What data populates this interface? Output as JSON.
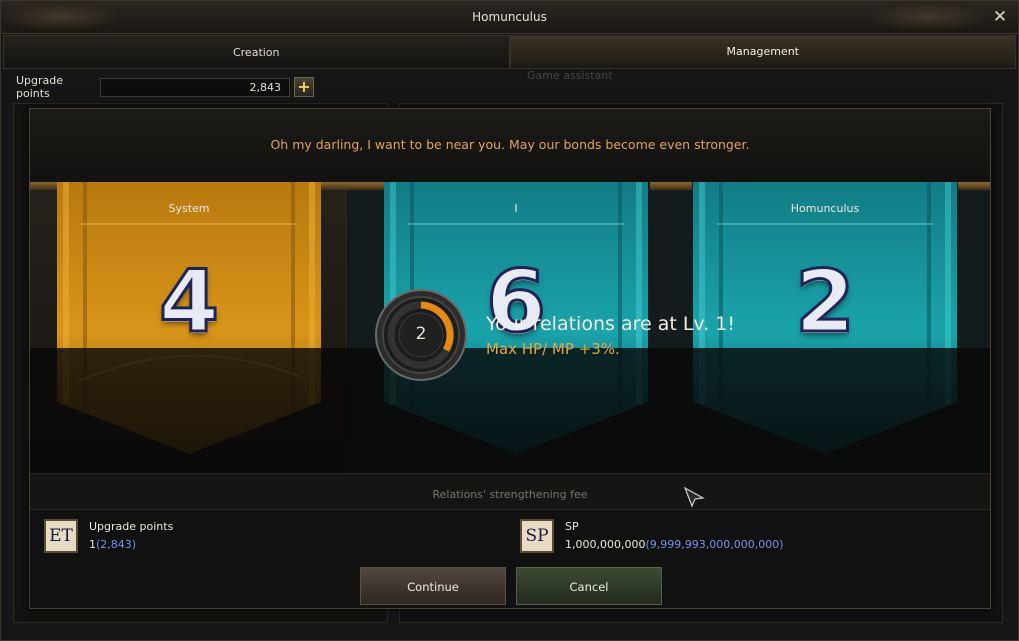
{
  "window": {
    "title": "Homunculus"
  },
  "tabs": [
    {
      "label": "Creation",
      "active": false
    },
    {
      "label": "Management",
      "active": true
    }
  ],
  "upgrade": {
    "label": "Upgrade points",
    "value": "2,843"
  },
  "background": {
    "assistant_text": "Game assistant"
  },
  "modal": {
    "message": "Oh my darling, I want to be near you. May our bonds become even stronger.",
    "banners": [
      {
        "label": "System",
        "number": "4",
        "color": "gold"
      },
      {
        "label": "I",
        "number": "6",
        "color": "teal"
      },
      {
        "label": "Homunculus",
        "number": "2",
        "color": "teal"
      }
    ],
    "level": {
      "number": "2",
      "title": "Your relations are at Lv. 1!",
      "bonus": "Max HP/ MP +3%."
    },
    "fee_label": "Relations' strengthening fee",
    "costs": [
      {
        "icon": "ET",
        "icon_name": "et-currency-icon",
        "name": "Upgrade points",
        "amount": "1",
        "owned": "(2,843)"
      },
      {
        "icon": "SP",
        "icon_name": "sp-currency-icon",
        "name": "SP",
        "amount": "1,000,000,000",
        "owned": "(9,999,993,000,000,000)"
      }
    ],
    "buttons": {
      "continue": "Continue",
      "cancel": "Cancel"
    }
  },
  "colors": {
    "accent_orange": "#e0a35e",
    "bonus_gold": "#e6a63d",
    "owned_blue": "#6f95e8",
    "banner_gold": "#c88a1e",
    "banner_teal": "#1e8c94"
  }
}
